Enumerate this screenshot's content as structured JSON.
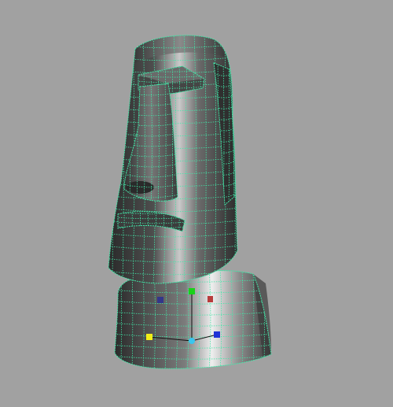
{
  "viewport": {
    "background_color": "#a1a1a1",
    "wireframe_color": "#43e6a8",
    "surface_dark": "#2b2b2b",
    "surface_mid": "#5c5c5c",
    "surface_light": "#e8e8e8"
  },
  "manipulator": {
    "pivot_color": "#39c6ee",
    "handles": [
      {
        "name": "green-handle",
        "color": "#19d219"
      },
      {
        "name": "red-handle",
        "color": "#b83c3c"
      },
      {
        "name": "navy-handle",
        "color": "#33368a"
      },
      {
        "name": "yellow-handle",
        "color": "#f2ee17"
      },
      {
        "name": "blue-handle",
        "color": "#1f33d6"
      }
    ]
  }
}
